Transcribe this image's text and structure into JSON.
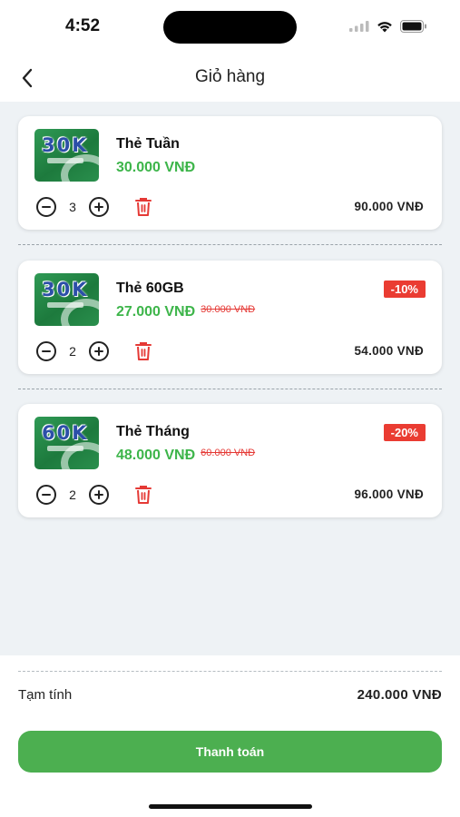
{
  "status_bar": {
    "time": "4:52"
  },
  "nav": {
    "title": "Giỏ hàng"
  },
  "cart": {
    "items": [
      {
        "thumb_label": "30K",
        "name": "Thẻ Tuần",
        "price": "30.000 VNĐ",
        "old_price": "",
        "discount": "",
        "quantity": "3",
        "line_total": "90.000 VNĐ"
      },
      {
        "thumb_label": "30K",
        "name": "Thẻ 60GB",
        "price": "27.000 VNĐ",
        "old_price": "30.000 VNĐ",
        "discount": "-10%",
        "quantity": "2",
        "line_total": "54.000 VNĐ"
      },
      {
        "thumb_label": "60K",
        "name": "Thẻ Tháng",
        "price": "48.000 VNĐ",
        "old_price": "60.000 VNĐ",
        "discount": "-20%",
        "quantity": "2",
        "line_total": "96.000 VNĐ"
      }
    ]
  },
  "summary": {
    "subtotal_label": "Tạm tính",
    "subtotal_value": "240.000 VNĐ"
  },
  "checkout": {
    "label": "Thanh toán"
  },
  "icons": {
    "back": "chevron-left-icon",
    "minus": "minus-circle-icon",
    "plus": "plus-circle-icon",
    "delete": "trash-icon",
    "wifi": "wifi-icon",
    "battery": "battery-icon",
    "signal": "signal-icon"
  },
  "colors": {
    "accent_green": "#3db54a",
    "button_green": "#4caf50",
    "discount_red": "#ea3c32",
    "background": "#eef2f5"
  }
}
